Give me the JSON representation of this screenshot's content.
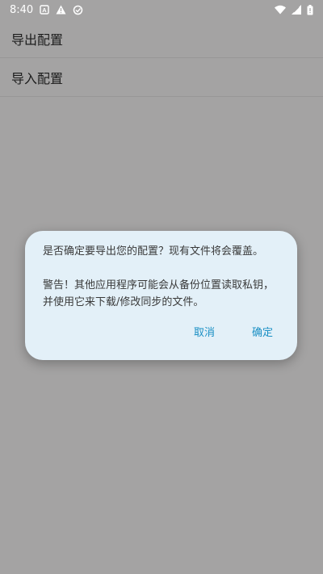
{
  "status_bar": {
    "time": "8:40",
    "left_icons": [
      "a-badge-icon",
      "warning-icon",
      "sync-icon"
    ],
    "right_icons": [
      "wifi-icon",
      "signal-icon",
      "battery-icon"
    ]
  },
  "menu": {
    "items": [
      {
        "label": "导出配置"
      },
      {
        "label": "导入配置"
      }
    ]
  },
  "dialog": {
    "message": "是否确定要导出您的配置？现有文件将会覆盖。\n\n警告！其他应用程序可能会从备份位置读取私钥，并使用它来下载/修改同步的文件。",
    "cancel_label": "取消",
    "confirm_label": "确定",
    "accent_color": "#1a8fc4",
    "background_color": "#e3f0f8"
  }
}
